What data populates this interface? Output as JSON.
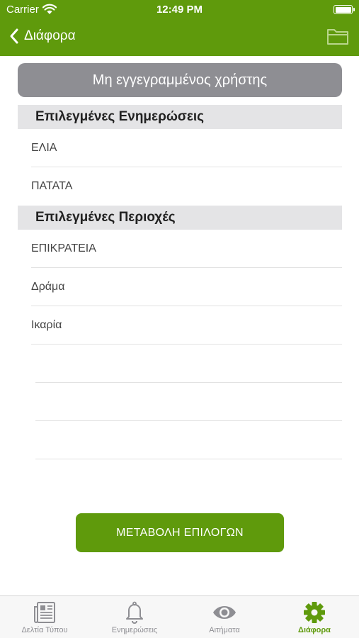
{
  "status_bar": {
    "carrier": "Carrier",
    "time": "12:49 PM"
  },
  "nav": {
    "back_label": "Διάφορα",
    "back_icon": "chevron-left-icon",
    "right_icon": "folder-icon"
  },
  "user_status": "Μη εγγεγραμμένος χρήστης",
  "sections": {
    "updates": {
      "title": "Επιλεγμένες Ενημερώσεις",
      "items": [
        "ΕΛΙΑ",
        "ΠΑΤΑΤΑ"
      ]
    },
    "regions": {
      "title": "Επιλεγμένες Περιοχές",
      "items": [
        "ΕΠΙΚΡΑΤΕΙΑ",
        "Δράμα",
        "Ικαρία"
      ]
    }
  },
  "action_button": "ΜΕΤΑΒΟΛΗ ΕΠΙΛΟΓΩΝ",
  "tabs": [
    {
      "label": "Δελτία Τύπου",
      "icon": "newspaper-icon",
      "active": false
    },
    {
      "label": "Ενημερώσεις",
      "icon": "bell-icon",
      "active": false
    },
    {
      "label": "Αιτήματα",
      "icon": "eye-icon",
      "active": false
    },
    {
      "label": "Διάφορα",
      "icon": "gear-icon",
      "active": true
    }
  ],
  "colors": {
    "accent": "#5f9a0c",
    "inactive_tab": "#8e8e93",
    "pill": "#8e8e93"
  }
}
